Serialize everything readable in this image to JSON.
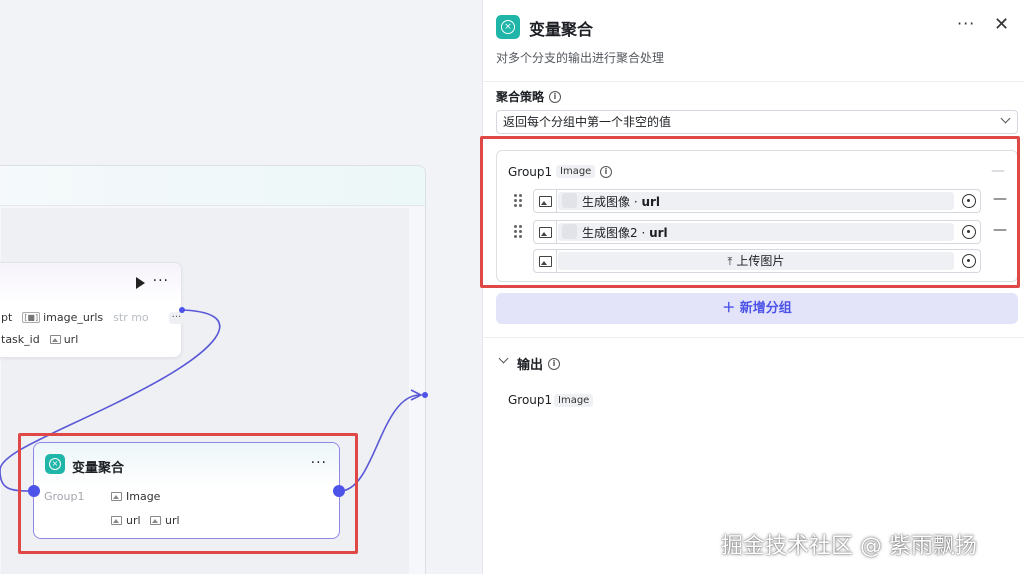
{
  "canvas": {
    "node_a": {
      "row1": {
        "partial": "pt",
        "image_urls": "image_urls",
        "faded": "str mo",
        "more": "···"
      },
      "row2": {
        "partial": "task_id",
        "url": "url"
      }
    },
    "node_b": {
      "title": "变量聚合",
      "more": "···",
      "group_label": "Group1",
      "type_label": "Image",
      "outputs": [
        "url",
        "url"
      ]
    }
  },
  "panel": {
    "title": "变量聚合",
    "description": "对多个分支的输出进行聚合处理",
    "more": "···",
    "close": "✕",
    "strategy": {
      "label": "聚合策略",
      "value": "返回每个分组中第一个非空的值"
    },
    "group": {
      "name": "Group1",
      "type": "Image",
      "rows": [
        {
          "source": "生成图像",
          "field": "url"
        },
        {
          "source": "生成图像2",
          "field": "url"
        }
      ],
      "upload_label": "上传图片"
    },
    "add_group": "新增分组",
    "output": {
      "label": "输出",
      "name": "Group1",
      "type": "Image"
    }
  },
  "watermark": "掘金技术社区 @ 紫雨飘扬",
  "colors": {
    "accent": "#4d53e8",
    "node_icon": "#1fb5a8",
    "highlight": "#e04848"
  }
}
